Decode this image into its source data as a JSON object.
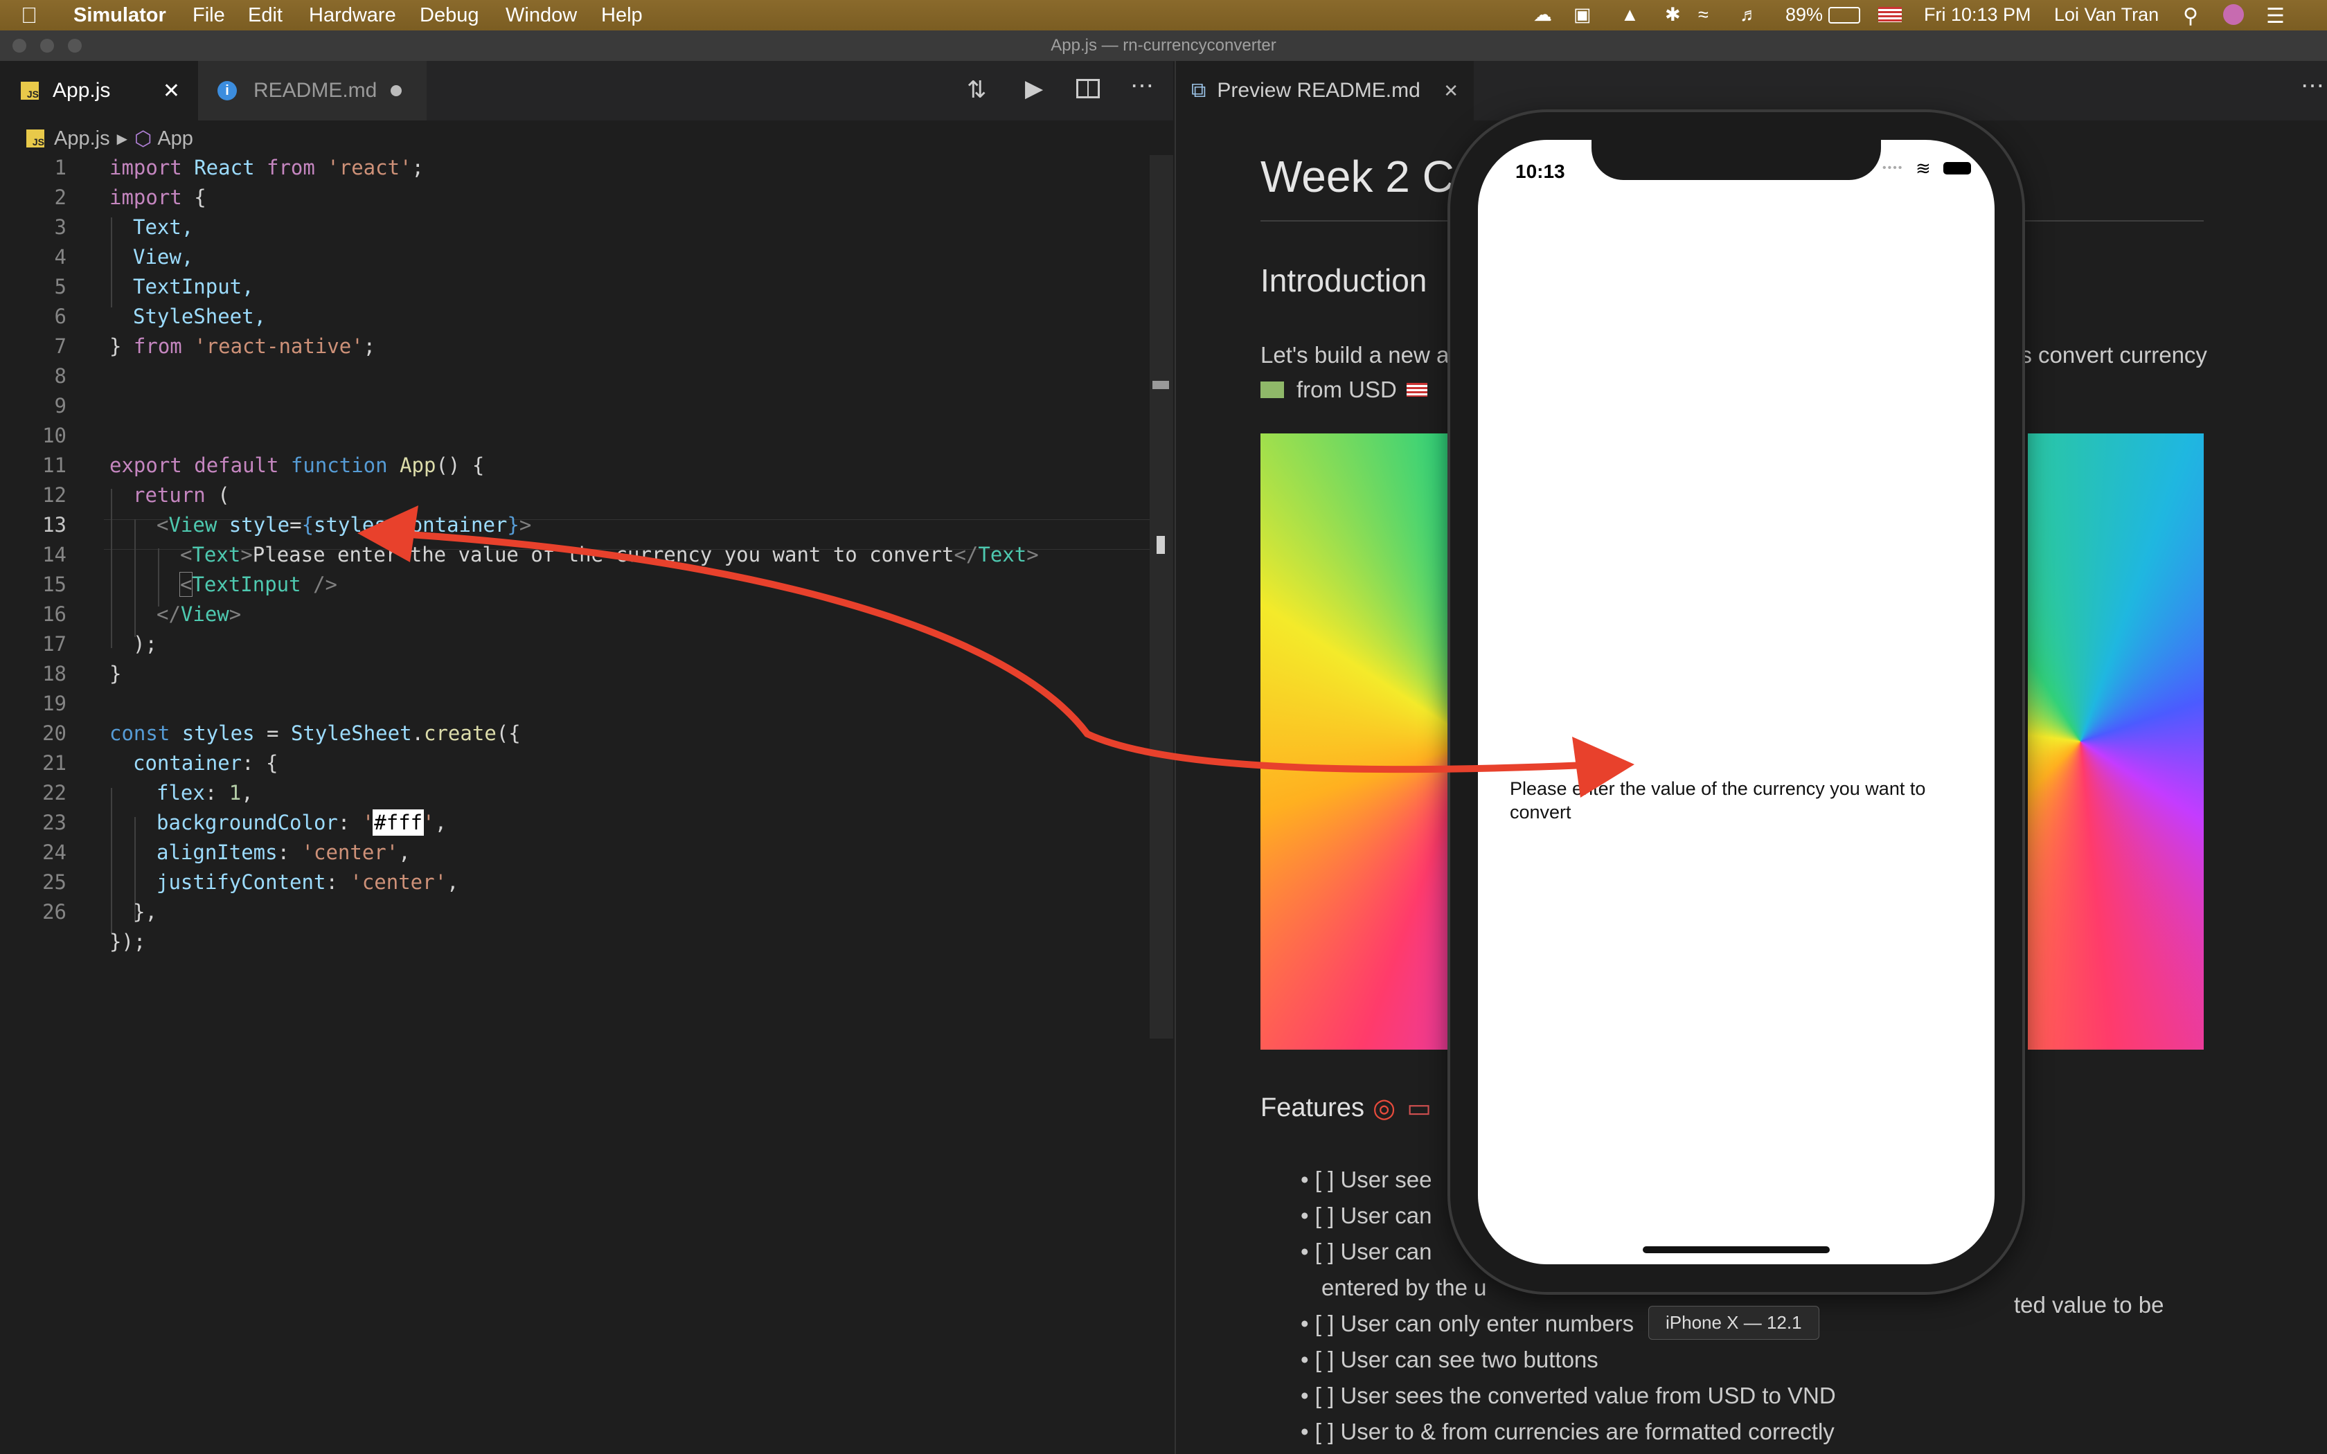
{
  "menubar": {
    "app_name": "Simulator",
    "items": [
      "File",
      "Edit",
      "Hardware",
      "Debug",
      "Window",
      "Help"
    ],
    "battery": "89%",
    "clock": "Fri 10:13 PM",
    "user": "Loi Van Tran"
  },
  "window": {
    "title": "App.js — rn-currencyconverter"
  },
  "editor": {
    "tabs": [
      {
        "label": "App.js"
      },
      {
        "label": "README.md"
      }
    ],
    "breadcrumb": {
      "file": "App.js",
      "symbol": "App"
    },
    "current_line": 13,
    "line_numbers": [
      "1",
      "2",
      "3",
      "4",
      "5",
      "6",
      "7",
      "8",
      "9",
      "10",
      "11",
      "12",
      "13",
      "14",
      "15",
      "16",
      "17",
      "18",
      "19",
      "20",
      "21",
      "22",
      "23",
      "24",
      "25",
      "26"
    ],
    "code": {
      "l1": [
        "import",
        " React ",
        "from",
        " 'react'",
        ";"
      ],
      "l2": [
        "import",
        " {"
      ],
      "l3": "Text,",
      "l4": "View,",
      "l5": "TextInput,",
      "l6": "StyleSheet,",
      "l7": [
        "} ",
        "from",
        " 'react-native'",
        ";"
      ],
      "l9": [
        "export",
        " ",
        "default",
        " ",
        "function",
        " ",
        "App",
        "() {"
      ],
      "l10": [
        "return",
        " ("
      ],
      "l11": [
        "<",
        "View",
        " ",
        "style",
        "=",
        "{",
        "styles.container",
        "}",
        ">"
      ],
      "l12": [
        "<",
        "Text",
        ">",
        "Please enter the value of the currency you want to convert",
        "</",
        "Text",
        ">"
      ],
      "l13": [
        "<",
        "TextInput",
        " />"
      ],
      "l14": [
        "</",
        "View",
        ">"
      ],
      "l15": ");",
      "l16": "}",
      "l18": [
        "const",
        " ",
        "styles",
        " = ",
        "StyleSheet",
        ".",
        "create",
        "({"
      ],
      "l19": [
        "container",
        ": {"
      ],
      "l20": [
        "flex",
        ": ",
        "1",
        ","
      ],
      "l21": [
        "backgroundColor",
        ": ",
        "'",
        "#fff",
        "'",
        ","
      ],
      "l22": [
        "alignItems",
        ": ",
        "'center'",
        ","
      ],
      "l23": [
        "justifyContent",
        ": ",
        "'center'",
        ","
      ],
      "l24": "},",
      "l25": "});"
    }
  },
  "preview": {
    "tab_label": "Preview README.md",
    "heading": "Week 2 C",
    "h2_intro": "Introduction",
    "intro_left": "Let's build a new a",
    "intro_right": "ers convert currency",
    "intro_line2": "from USD",
    "h2_features": "Features",
    "features": [
      "[ ] User see",
      "[ ] User can",
      "[ ] User can",
      "[ ] User can only enter numbers",
      "[ ] User can see two buttons",
      "[ ] User sees the converted value from USD to VND",
      "[ ] User to & from currencies are formatted correctly"
    ],
    "feature3_right": "ted value to be",
    "feature3_cont": "entered by the u"
  },
  "simulator": {
    "time": "10:13",
    "app_text": "Please enter the value of the currency you want to convert",
    "device_label": "iPhone X — 12.1"
  },
  "colors": {
    "accent_arrow": "#e8412c",
    "menubar": "#7b5d22",
    "editor_bg": "#1e1e1e"
  }
}
